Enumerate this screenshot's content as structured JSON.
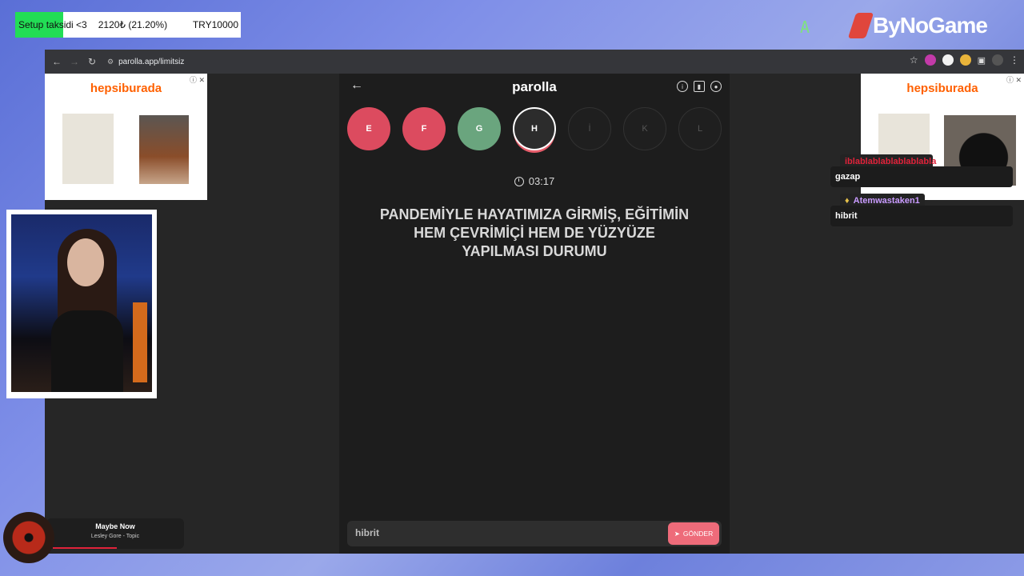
{
  "overlay": {
    "donation_label": "Setup taksidi <3",
    "donation_amount": "2120₺ (21.20%)",
    "donation_goal": "TRY10000",
    "donation_progress": 0.212,
    "corner_letter": "A",
    "brand": "ByNoGame"
  },
  "browser": {
    "url": "parolla.app/limitsiz"
  },
  "ads": {
    "left_brand": "hepsiburada",
    "right_brand": "hepsiburada"
  },
  "app": {
    "title": "parolla",
    "letters": [
      {
        "char": "E",
        "state": "wrong"
      },
      {
        "char": "F",
        "state": "wrong"
      },
      {
        "char": "G",
        "state": "right"
      },
      {
        "char": "H",
        "state": "current"
      },
      {
        "char": "İ",
        "state": "pending"
      },
      {
        "char": "K",
        "state": "pending"
      },
      {
        "char": "L",
        "state": "pending"
      }
    ],
    "timer": "03:17",
    "question": "PANDEMİYLE HAYATIMIZA GİRMİŞ, EĞİTİMİN HEM ÇEVRİMİÇİ HEM DE YÜZYÜZE YAPILMASI DURUMU",
    "answer_value": "hibrit",
    "send_label": "GÖNDER"
  },
  "chat": [
    {
      "user": "iblablablablablablabla",
      "message": "gazap",
      "color": "#e0223a"
    },
    {
      "user": "Atemwastaken1",
      "message": "hibrit",
      "color": "#c99bff"
    }
  ],
  "music": {
    "song": "Maybe Now",
    "artist": "Lesley Gore - Topic"
  },
  "colors": {
    "wrong": "#dc4b5f",
    "right": "#6aa57e",
    "accent": "#ee6b7a"
  }
}
